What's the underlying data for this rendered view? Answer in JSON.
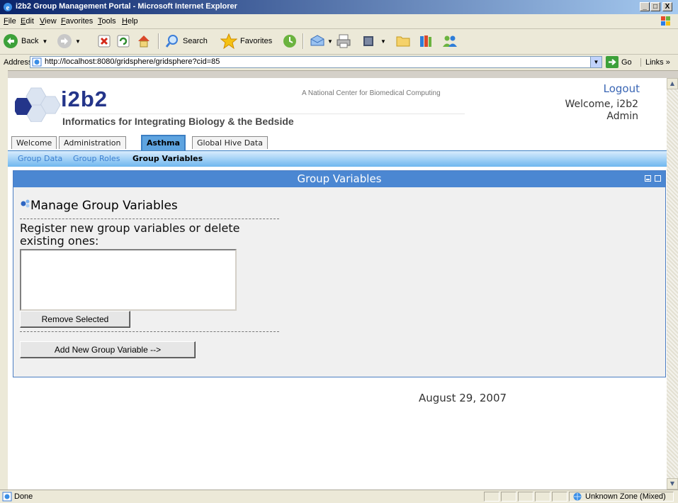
{
  "window": {
    "title": "i2b2 Group Management Portal - Microsoft Internet Explorer",
    "controls": [
      "_",
      "□",
      "X"
    ]
  },
  "menu": [
    "File",
    "Edit",
    "View",
    "Favorites",
    "Tools",
    "Help"
  ],
  "toolbar": {
    "back_label": "Back",
    "search_label": "Search",
    "favorites_label": "Favorites"
  },
  "address": {
    "label": "Address",
    "url": "http://localhost:8080/gridsphere/gridsphere?cid=85",
    "go_label": "Go",
    "links_label": "Links »"
  },
  "header": {
    "logo": "i2b2",
    "subtitle": "Informatics for Integrating Biology & the Bedside",
    "tagline": "A National Center for Biomedical Computing",
    "logout": "Logout",
    "welcome_line1": "Welcome, i2b2",
    "welcome_line2": "Admin"
  },
  "tabs": [
    {
      "label": "Welcome",
      "active": false
    },
    {
      "label": "Administration",
      "active": false
    },
    {
      "label": "Asthma",
      "active": true
    },
    {
      "label": "Global Hive Data",
      "active": false
    }
  ],
  "subnav": [
    {
      "label": "Group Data",
      "active": false
    },
    {
      "label": "Group Roles",
      "active": false
    },
    {
      "label": "Group Variables",
      "active": true
    }
  ],
  "portlet": {
    "title": "Group Variables",
    "section_title": "Manage Group Variables",
    "description": "Register new group variables or delete existing ones:",
    "remove_button": "Remove Selected",
    "add_button": "Add New Group Variable -->"
  },
  "date": "August 29, 2007",
  "status": {
    "text": "Done",
    "zone": "Unknown Zone (Mixed)"
  },
  "colors": {
    "accent": "#4b87d2",
    "brand": "#24358a",
    "titlebar": "#0a246a"
  }
}
